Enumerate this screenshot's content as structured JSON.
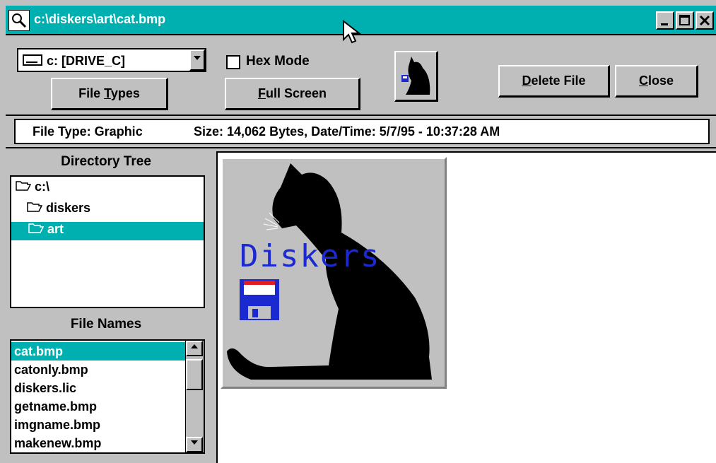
{
  "window": {
    "title": "c:\\diskers\\art\\cat.bmp",
    "controls": {
      "minimize": "_",
      "maximize": "□",
      "close": "✕"
    }
  },
  "toolbar": {
    "drive": "c: [DRIVE_C]",
    "file_types_prefix": "File ",
    "file_types_accel": "T",
    "file_types_suffix": "ypes",
    "hex_mode_label": "Hex Mode",
    "hex_mode_checked": false,
    "full_screen_accel": "F",
    "full_screen_suffix": "ull Screen",
    "delete_accel": "D",
    "delete_suffix": "elete File",
    "close_accel": "C",
    "close_suffix": "lose"
  },
  "info": {
    "file_type": "File Type: Graphic",
    "size_date": "Size: 14,062 Bytes, Date/Time: 5/7/95 - 10:37:28 AM"
  },
  "directory_tree": {
    "label": "Directory Tree",
    "items": [
      {
        "label": "c:\\",
        "selected": false
      },
      {
        "label": "diskers",
        "selected": false
      },
      {
        "label": "art",
        "selected": true
      }
    ]
  },
  "file_names": {
    "label": "File Names",
    "items": [
      {
        "label": "cat.bmp",
        "selected": true
      },
      {
        "label": "catonly.bmp",
        "selected": false
      },
      {
        "label": "diskers.lic",
        "selected": false
      },
      {
        "label": "getname.bmp",
        "selected": false
      },
      {
        "label": "imgname.bmp",
        "selected": false
      },
      {
        "label": "makenew.bmp",
        "selected": false
      }
    ]
  },
  "preview": {
    "logo_text": "Diskers"
  },
  "colors": {
    "accent": "#00b0b0",
    "face": "#c0c0c0",
    "logo_blue": "#1a2ad0"
  }
}
